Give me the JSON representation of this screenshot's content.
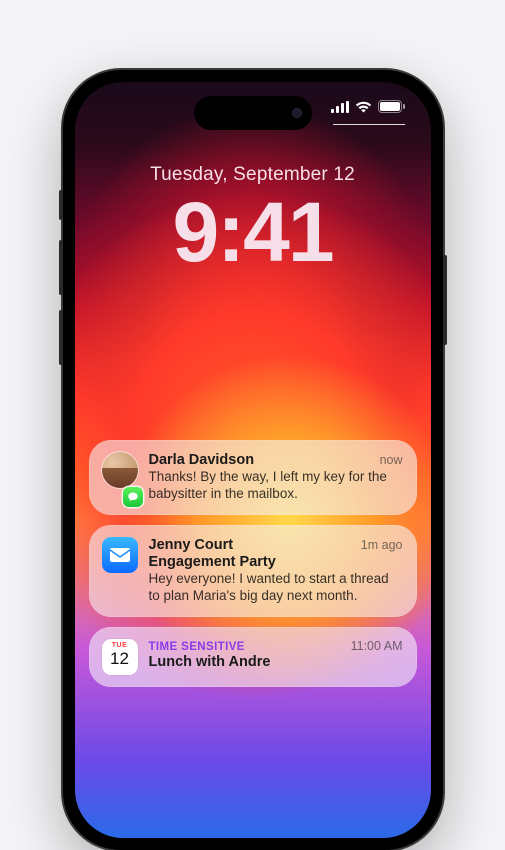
{
  "status": {
    "cellular_bars": 4,
    "wifi_on": true,
    "battery_icon": "battery-full-icon"
  },
  "lock": {
    "date": "Tuesday, September 12",
    "time": "9:41"
  },
  "notifications": [
    {
      "app": "messages",
      "sender": "Darla Davidson",
      "preview": "Thanks! By the way, I left my key for the babysitter in the mailbox.",
      "ts": "now"
    },
    {
      "app": "mail",
      "sender": "Jenny Court",
      "subject": "Engagement Party",
      "preview": "Hey everyone! I wanted to start a thread to plan Maria's big day next month.",
      "ts": "1m ago"
    },
    {
      "app": "calendar",
      "tag": "TIME SENSITIVE",
      "subject": "Lunch with Andre",
      "ts": "11:00 AM",
      "cal_day_label": "TUE",
      "cal_day_num": "12"
    }
  ]
}
